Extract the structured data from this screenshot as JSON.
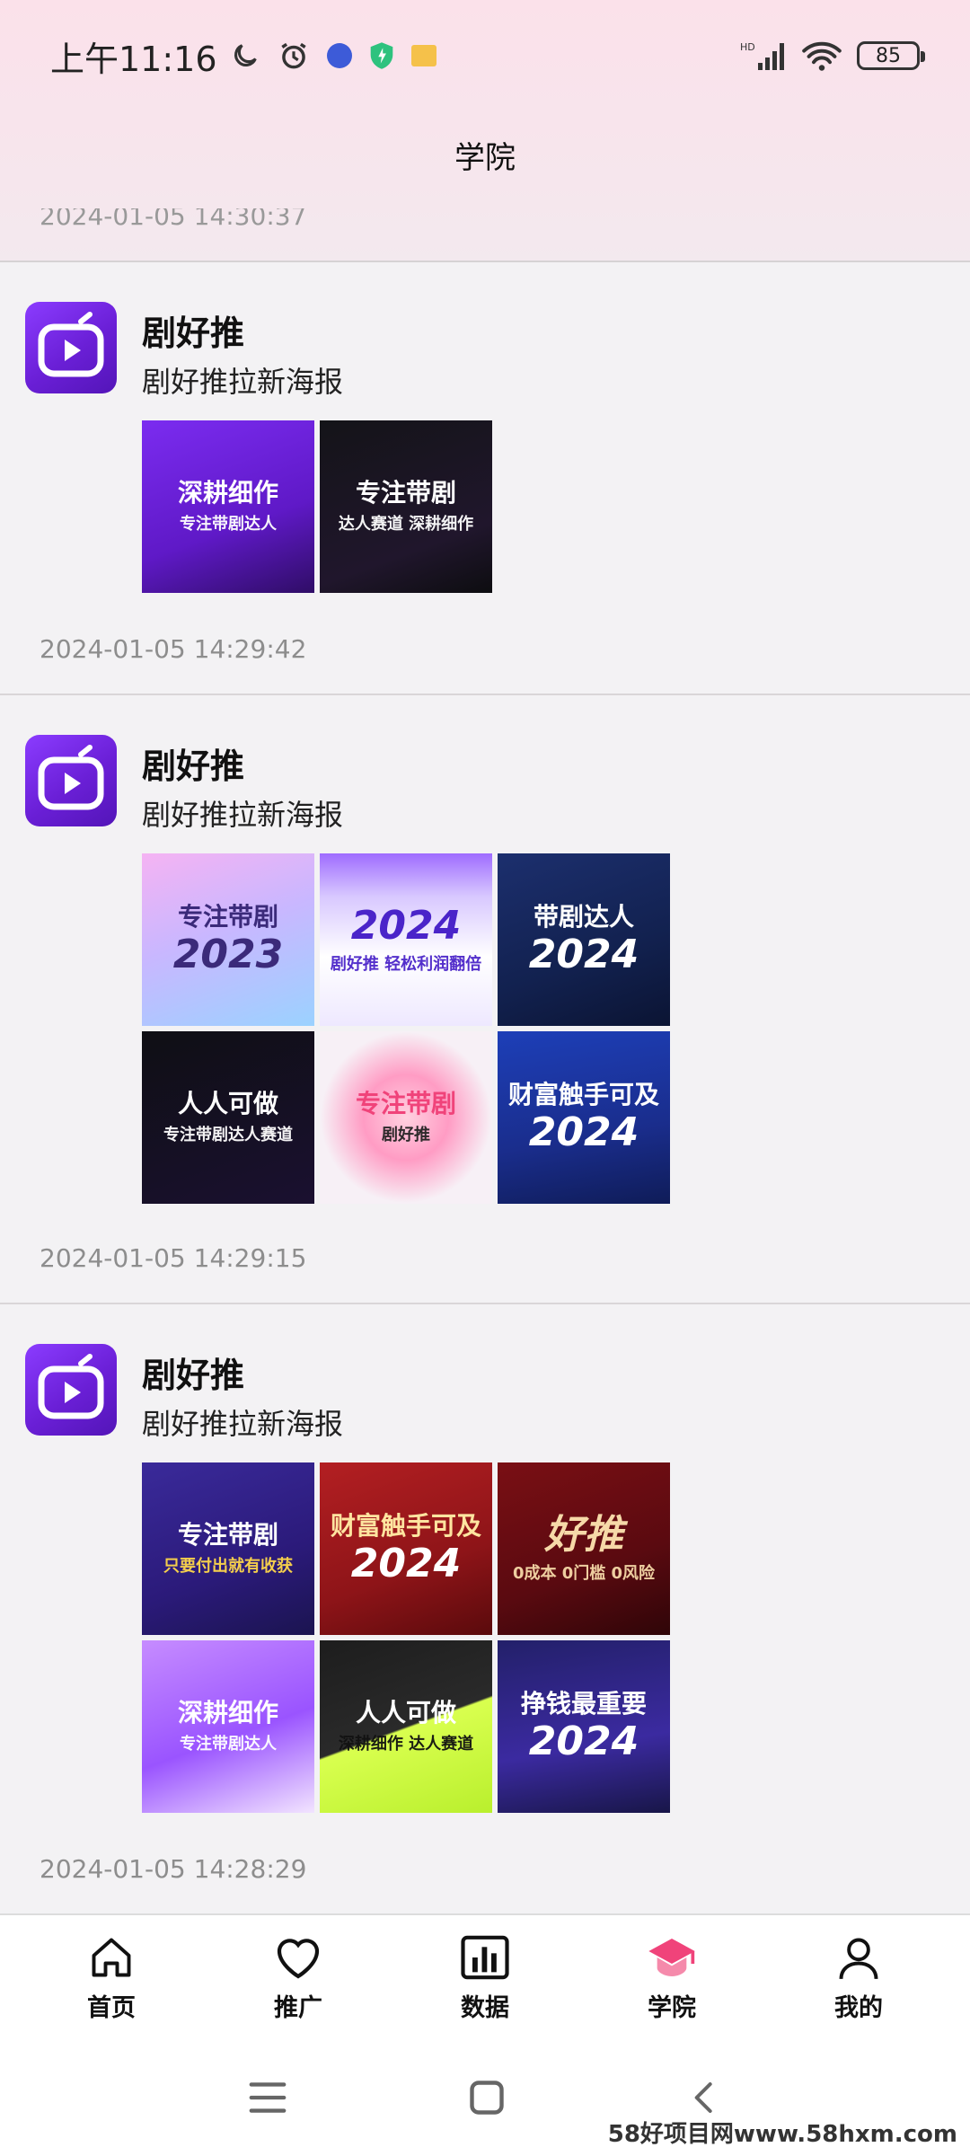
{
  "status_bar": {
    "time": "上午11:16",
    "battery": "85"
  },
  "header": {
    "title": "学院",
    "scrolled_timestamp": "2024-01-05 14:30:37"
  },
  "posts": [
    {
      "name": "剧好推",
      "text": "剧好推拉新海报",
      "timestamp": "2024-01-05 14:29:42",
      "images": [
        {
          "title": "深耕细作",
          "sub": "专注带剧达人"
        },
        {
          "title": "专注带剧",
          "sub": "达人赛道 深耕细作"
        }
      ]
    },
    {
      "name": "剧好推",
      "text": "剧好推拉新海报",
      "timestamp": "2024-01-05 14:29:15",
      "images": [
        {
          "title": "专注带剧",
          "sub": "2023"
        },
        {
          "title": "2024",
          "sub": "剧好推 轻松利润翻倍"
        },
        {
          "title": "带剧达人",
          "sub": "2024"
        },
        {
          "title": "人人可做",
          "sub": "专注带剧达人赛道"
        },
        {
          "title": "专注带剧",
          "sub": "剧好推"
        },
        {
          "title": "财富触手可及",
          "sub": "2024"
        }
      ]
    },
    {
      "name": "剧好推",
      "text": "剧好推拉新海报",
      "timestamp": "2024-01-05 14:28:29",
      "images": [
        {
          "title": "专注带剧",
          "sub": "只要付出就有收获"
        },
        {
          "title": "财富触手可及",
          "sub": "2024"
        },
        {
          "title": "好推",
          "sub": "0成本 0门槛 0风险"
        },
        {
          "title": "深耕细作",
          "sub": "专注带剧达人"
        },
        {
          "title": "人人可做",
          "sub": "深耕细作 达人赛道"
        },
        {
          "title": "挣钱最重要",
          "sub": "2024"
        }
      ]
    }
  ],
  "tabbar": {
    "items": [
      {
        "label": "首页",
        "icon": "home-icon"
      },
      {
        "label": "推广",
        "icon": "heart-icon"
      },
      {
        "label": "数据",
        "icon": "bar-chart-icon"
      },
      {
        "label": "学院",
        "icon": "graduation-cap-icon"
      },
      {
        "label": "我的",
        "icon": "person-icon"
      }
    ],
    "active_index": 3,
    "active_color": "#f0437a"
  },
  "system_nav": {
    "menu_icon": "menu-icon",
    "home_icon": "square-home-icon",
    "back_icon": "back-chevron-icon"
  },
  "watermark": "58好项目网www.58hxm.com"
}
